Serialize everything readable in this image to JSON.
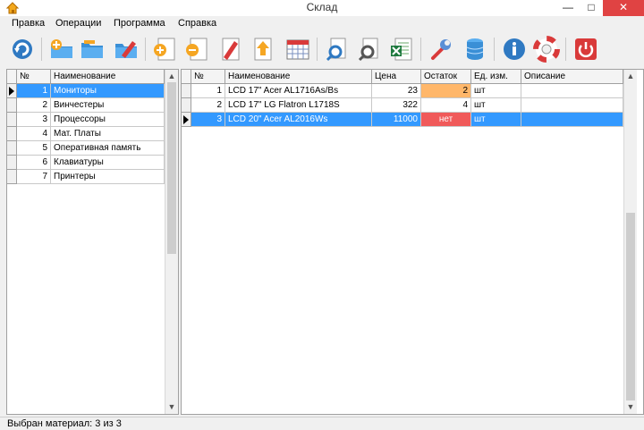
{
  "window": {
    "title": "Склад",
    "close_glyph": "✕",
    "minimize_glyph": "—",
    "maximize_glyph": "□"
  },
  "menu": [
    "Правка",
    "Операции",
    "Программа",
    "Справка"
  ],
  "toolbar": [
    "refresh-icon",
    "add-folder-icon",
    "open-folder-icon",
    "edit-folder-icon",
    "add-document-icon",
    "remove-document-icon",
    "edit-document-icon",
    "export-document-icon",
    "calendar-table-icon",
    "search-document-icon",
    "search-document-alt-icon",
    "excel-export-icon",
    "wrench-settings-icon",
    "database-icon",
    "info-icon",
    "help-lifebuoy-icon",
    "power-exit-icon"
  ],
  "categories": {
    "columns": [
      "№",
      "Наименование"
    ],
    "rows": [
      {
        "n": "1",
        "name": "Мониторы",
        "selected": true
      },
      {
        "n": "2",
        "name": "Винчестеры"
      },
      {
        "n": "3",
        "name": "Процессоры"
      },
      {
        "n": "4",
        "name": "Мат. Платы"
      },
      {
        "n": "5",
        "name": "Оперативная память"
      },
      {
        "n": "6",
        "name": "Клавиатуры"
      },
      {
        "n": "7",
        "name": "Принтеры"
      }
    ]
  },
  "items": {
    "columns": [
      "№",
      "Наименование",
      "Цена",
      "Остаток",
      "Ед. изм.",
      "Описание"
    ],
    "rows": [
      {
        "n": "1",
        "name": "LCD 17\" Acer AL1716As/Bs",
        "price": "23",
        "stock": "2",
        "stock_status": "low",
        "unit": "шт",
        "desc": ""
      },
      {
        "n": "2",
        "name": "LCD 17\" LG Flatron L1718S",
        "price": "322",
        "stock": "4",
        "stock_status": "ok",
        "unit": "шт",
        "desc": ""
      },
      {
        "n": "3",
        "name": "LCD 20\" Acer AL2016Ws",
        "price": "11000",
        "stock": "нет",
        "stock_status": "out",
        "unit": "шт",
        "desc": "",
        "selected": true
      }
    ]
  },
  "colors": {
    "selection": "#3399ff",
    "stock_low": "#ffb76a",
    "stock_out": "#f05a5a",
    "close_button": "#e04343"
  },
  "status": {
    "text": "Выбран материал: 3 из 3"
  }
}
